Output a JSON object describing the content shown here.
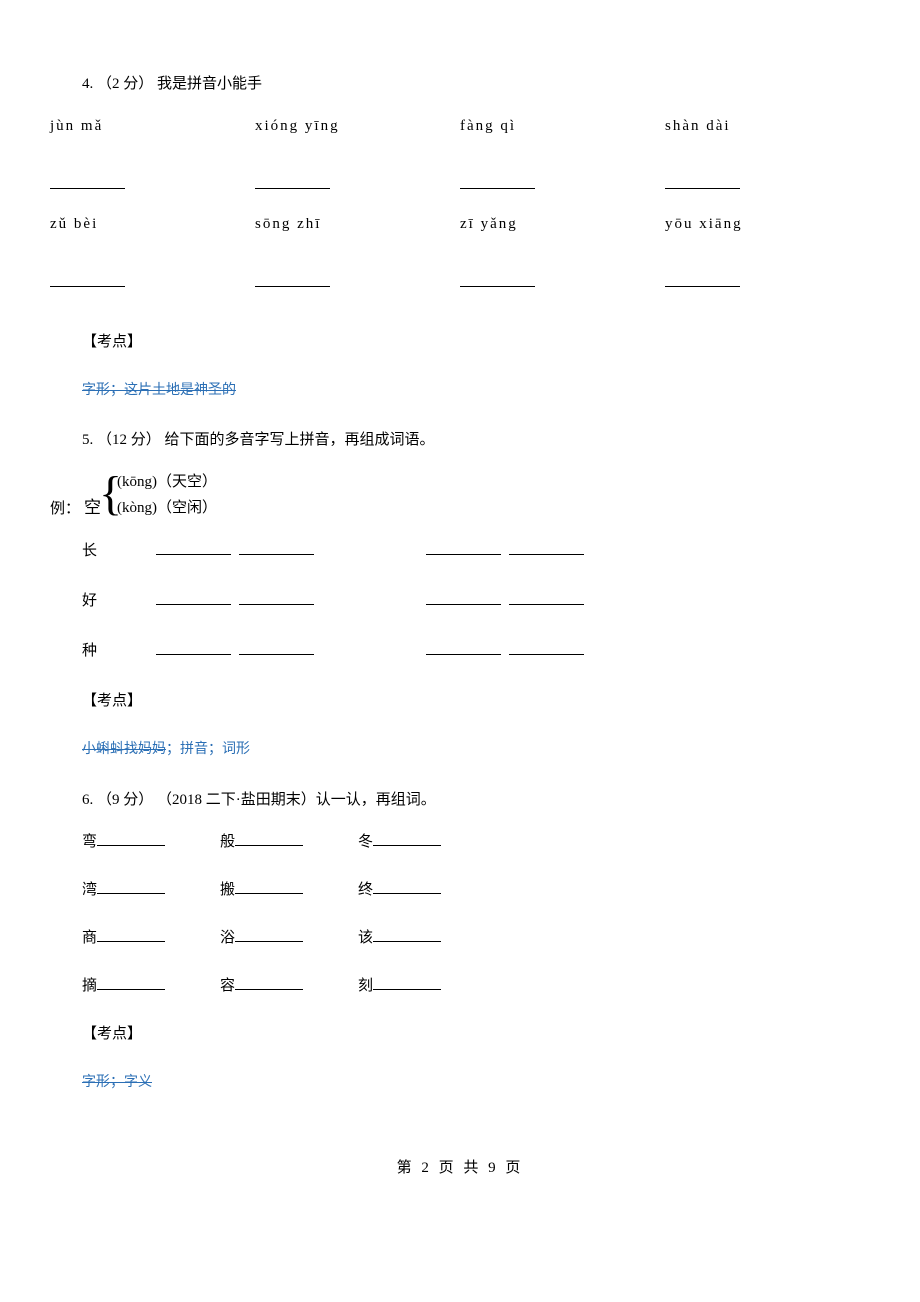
{
  "q4": {
    "header": "4. （2 分） 我是拼音小能手",
    "row1": [
      "jùn mǎ",
      "xióng yīng",
      "fàng qì",
      "shàn dài"
    ],
    "row2": [
      "zǔ bèi",
      "sōng zhī",
      "zī yǎng",
      "yōu xiāng"
    ],
    "kaodian_label": "【考点】",
    "kaodian_content": "字形；这片土地是神圣的"
  },
  "q5": {
    "header": "5. （12 分） 给下面的多音字写上拼音，再组成词语。",
    "example_label": "例：",
    "example_char": "空",
    "example_lines": [
      "(kōng)（天空）",
      "(kòng)（空闲）"
    ],
    "chars": [
      "长",
      "好",
      "种"
    ],
    "kaodian_label": "【考点】",
    "kaodian_content_strike": "小蝌蚪找妈妈",
    "kaodian_content_plain": "；拼音；词形"
  },
  "q6": {
    "header": "6. （9 分） （2018 二下·盐田期末）认一认，再组词。",
    "rows": [
      [
        "弯",
        "般",
        "冬"
      ],
      [
        "湾",
        "搬",
        "终"
      ],
      [
        "商",
        "浴",
        "该"
      ],
      [
        "摘",
        "容",
        "刻"
      ]
    ],
    "kaodian_label": "【考点】",
    "kaodian_content": "字形；字义"
  },
  "footer": "第 2 页 共 9 页"
}
